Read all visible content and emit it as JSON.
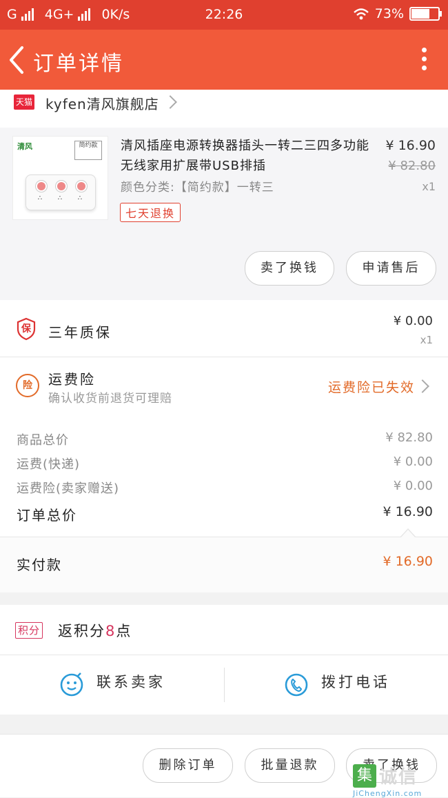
{
  "status_bar": {
    "carrier_left": "G",
    "network": "4G+",
    "speed": "0K/s",
    "time": "22:26",
    "battery": "73%",
    "battery_level": 0.73
  },
  "nav": {
    "title": "订单详情"
  },
  "shop": {
    "badge": "天猫",
    "name": "kyfen清风旗舰店"
  },
  "product": {
    "thumb_brand": "清风",
    "thumb_tag": "简约款",
    "title": "清风插座电源转换器插头一转二三四多功能无线家用扩展带USB排插",
    "spec": "颜色分类:【简约款】一转三",
    "badge": "七天退换",
    "price": "¥ 16.90",
    "original_price": "¥ 82.80",
    "quantity": "x1",
    "buttons": [
      "卖了换钱",
      "申请售后"
    ]
  },
  "warranty": {
    "icon_char": "保",
    "title": "三年质保",
    "price": "¥ 0.00",
    "quantity": "x1"
  },
  "insurance": {
    "icon_char": "险",
    "title": "运费险",
    "subtitle": "确认收货前退货可理赔",
    "status": "运费险已失效"
  },
  "summary": {
    "lines": [
      {
        "label": "商品总价",
        "value": "¥ 82.80"
      },
      {
        "label": "运费(快递)",
        "value": "¥ 0.00"
      },
      {
        "label": "运费险(卖家赠送)",
        "value": "¥ 0.00"
      }
    ],
    "total_label": "订单总价",
    "total_value": "¥ 16.90"
  },
  "paid": {
    "label": "实付款",
    "value": "¥ 16.90"
  },
  "points": {
    "badge": "积分",
    "prefix": "返积分",
    "count": "8",
    "suffix": "点"
  },
  "contact": {
    "seller": "联系卖家",
    "phone": "拨打电话"
  },
  "bottom_actions": [
    "删除订单",
    "批量退款",
    "卖了换钱"
  ],
  "watermark": {
    "char": "集",
    "cn": "诚信",
    "en": "JiChengXin.com"
  },
  "colors": {
    "status_bar": "#e0402f",
    "nav": "#f15a3a",
    "accent_orange": "#e26a28",
    "points_pink": "#d6355e",
    "contact_blue": "#2a9bd8"
  }
}
